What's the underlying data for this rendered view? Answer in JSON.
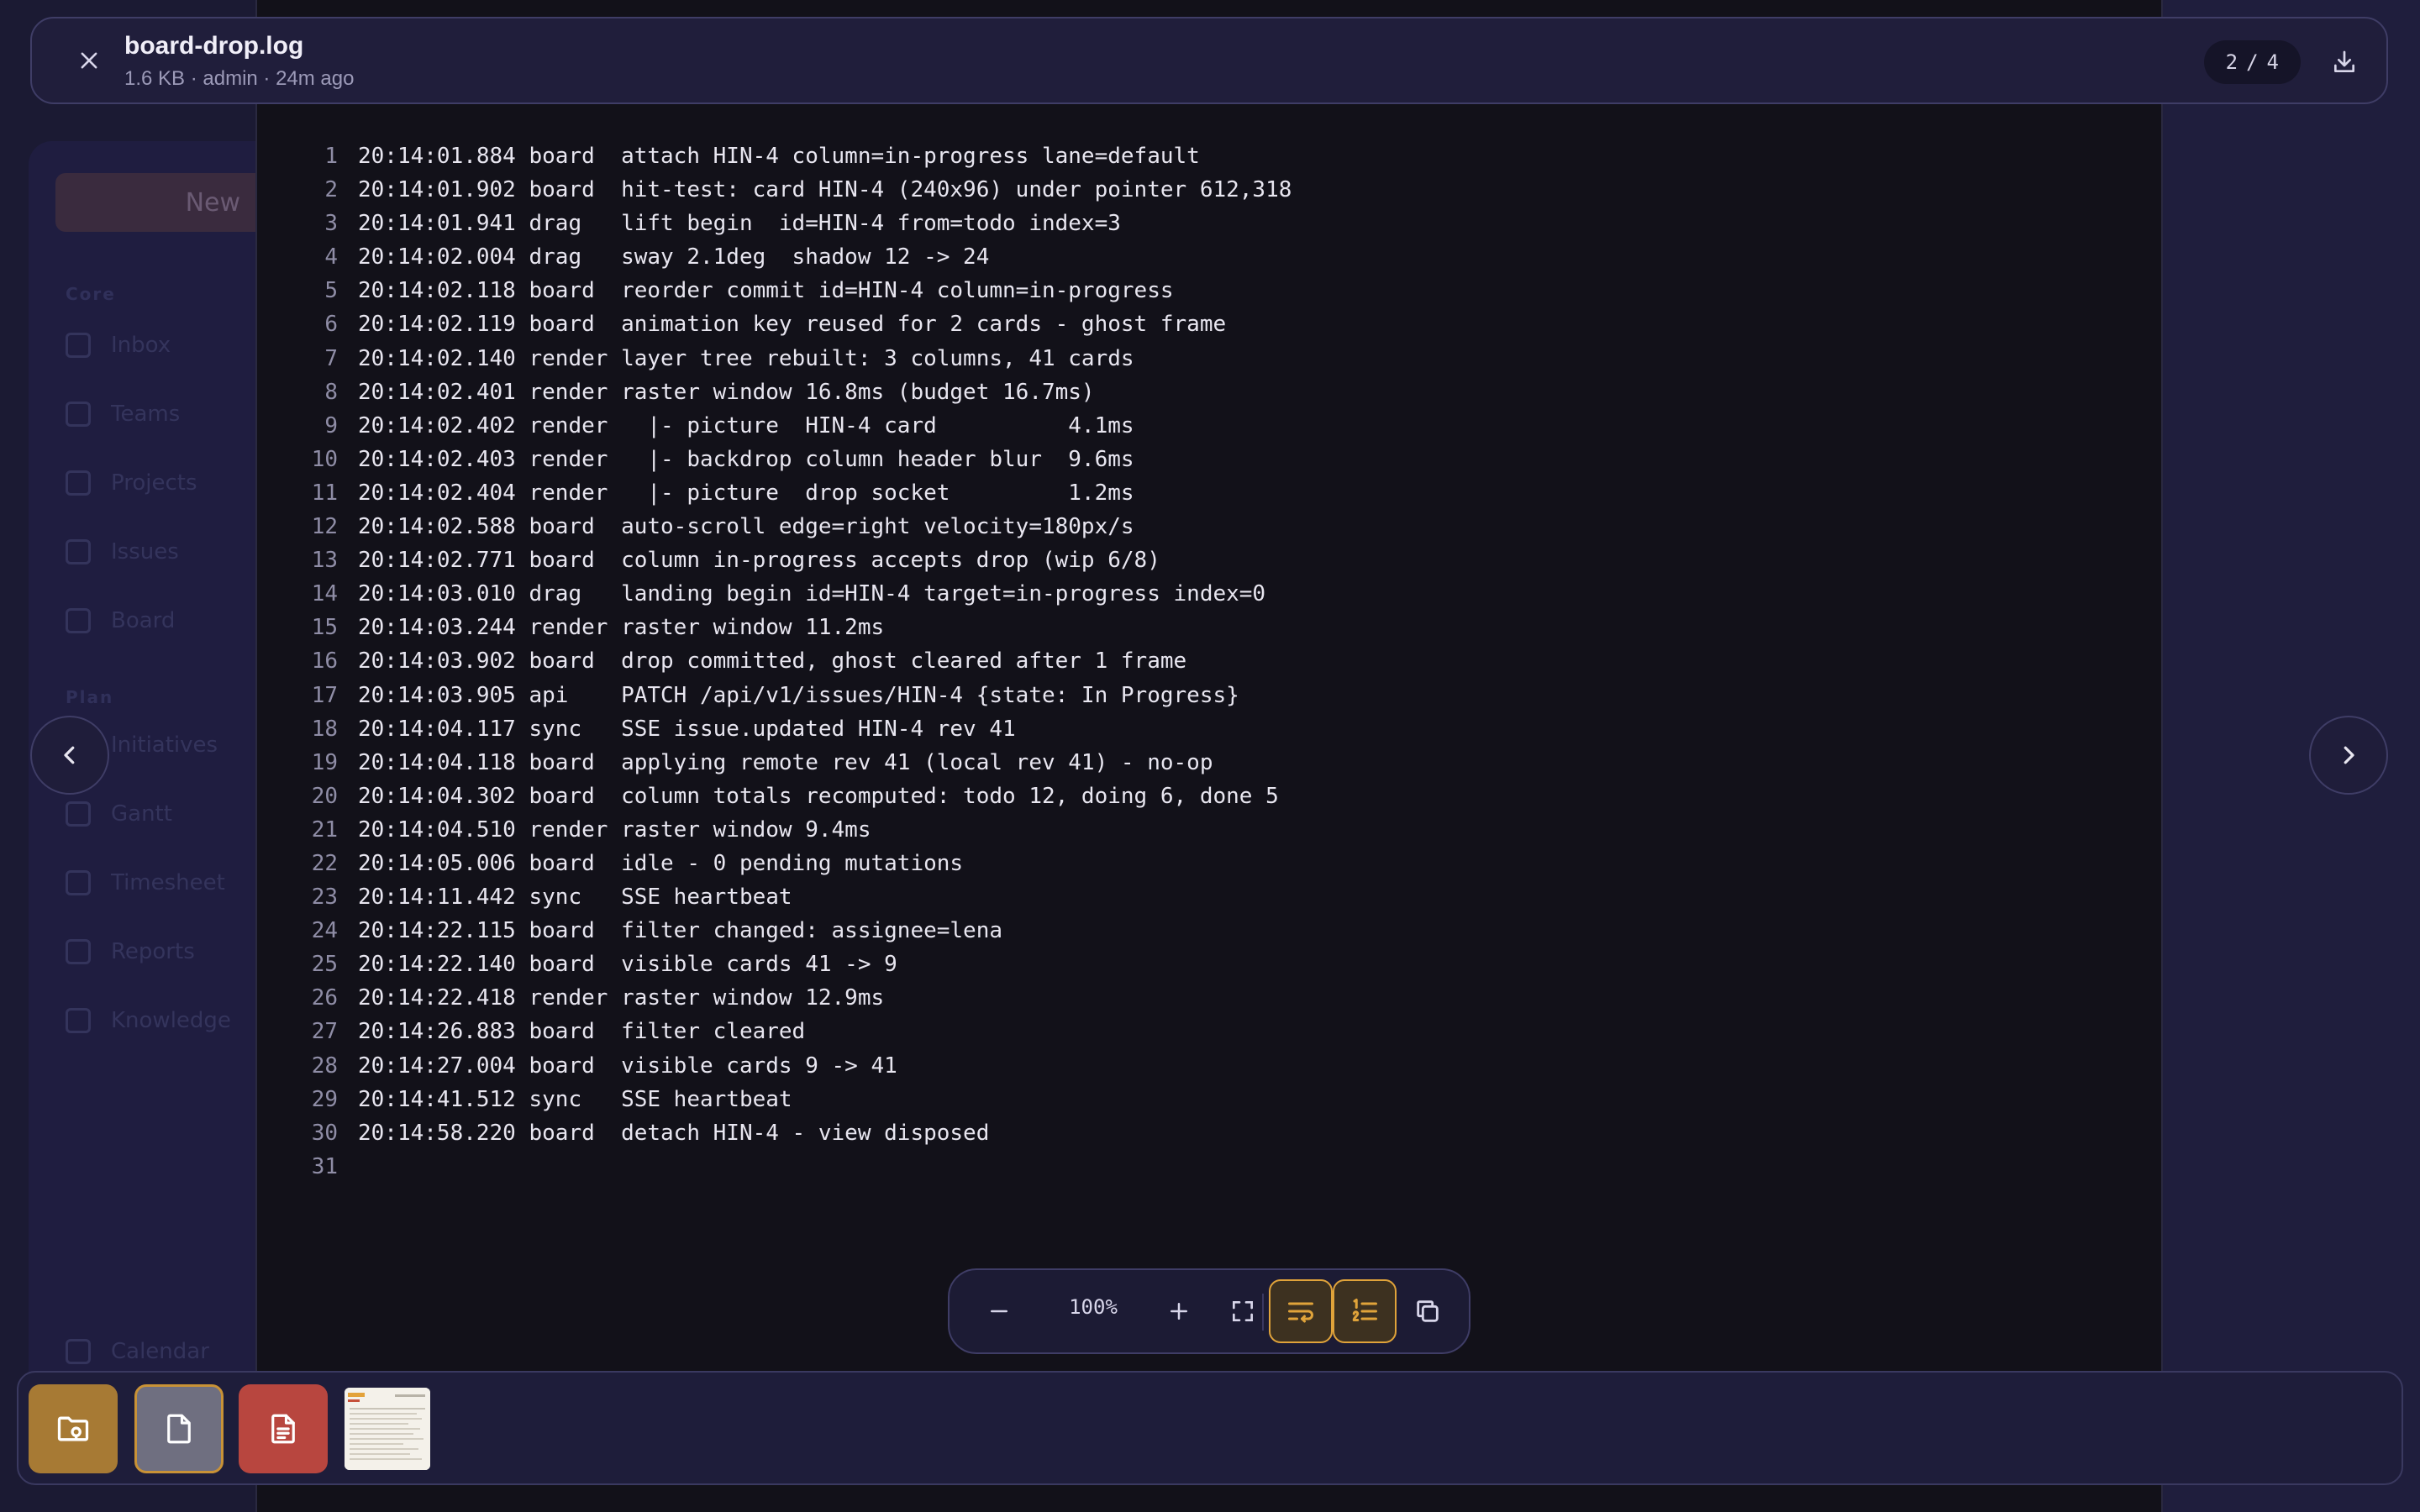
{
  "file": {
    "name": "board-drop.log",
    "meta": "1.6 KB · admin · 24m ago"
  },
  "pager": {
    "current": "2",
    "separator": "/",
    "total": "4"
  },
  "log_lines": [
    {
      "n": "1",
      "text": "20:14:01.884 board  attach HIN-4 column=in-progress lane=default"
    },
    {
      "n": "2",
      "text": "20:14:01.902 board  hit-test: card HIN-4 (240x96) under pointer 612,318"
    },
    {
      "n": "3",
      "text": "20:14:01.941 drag   lift begin  id=HIN-4 from=todo index=3"
    },
    {
      "n": "4",
      "text": "20:14:02.004 drag   sway 2.1deg  shadow 12 -> 24"
    },
    {
      "n": "5",
      "text": "20:14:02.118 board  reorder commit id=HIN-4 column=in-progress"
    },
    {
      "n": "6",
      "text": "20:14:02.119 board  animation key reused for 2 cards - ghost frame"
    },
    {
      "n": "7",
      "text": "20:14:02.140 render layer tree rebuilt: 3 columns, 41 cards"
    },
    {
      "n": "8",
      "text": "20:14:02.401 render raster window 16.8ms (budget 16.7ms)"
    },
    {
      "n": "9",
      "text": "20:14:02.402 render   |- picture  HIN-4 card          4.1ms"
    },
    {
      "n": "10",
      "text": "20:14:02.403 render   |- backdrop column header blur  9.6ms"
    },
    {
      "n": "11",
      "text": "20:14:02.404 render   |- picture  drop socket         1.2ms"
    },
    {
      "n": "12",
      "text": "20:14:02.588 board  auto-scroll edge=right velocity=180px/s"
    },
    {
      "n": "13",
      "text": "20:14:02.771 board  column in-progress accepts drop (wip 6/8)"
    },
    {
      "n": "14",
      "text": "20:14:03.010 drag   landing begin id=HIN-4 target=in-progress index=0"
    },
    {
      "n": "15",
      "text": "20:14:03.244 render raster window 11.2ms"
    },
    {
      "n": "16",
      "text": "20:14:03.902 board  drop committed, ghost cleared after 1 frame"
    },
    {
      "n": "17",
      "text": "20:14:03.905 api    PATCH /api/v1/issues/HIN-4 {state: In Progress}"
    },
    {
      "n": "18",
      "text": "20:14:04.117 sync   SSE issue.updated HIN-4 rev 41"
    },
    {
      "n": "19",
      "text": "20:14:04.118 board  applying remote rev 41 (local rev 41) - no-op"
    },
    {
      "n": "20",
      "text": "20:14:04.302 board  column totals recomputed: todo 12, doing 6, done 5"
    },
    {
      "n": "21",
      "text": "20:14:04.510 render raster window 9.4ms"
    },
    {
      "n": "22",
      "text": "20:14:05.006 board  idle - 0 pending mutations"
    },
    {
      "n": "23",
      "text": "20:14:11.442 sync   SSE heartbeat"
    },
    {
      "n": "24",
      "text": "20:14:22.115 board  filter changed: assignee=lena"
    },
    {
      "n": "25",
      "text": "20:14:22.140 board  visible cards 41 -> 9"
    },
    {
      "n": "26",
      "text": "20:14:22.418 render raster window 12.9ms"
    },
    {
      "n": "27",
      "text": "20:14:26.883 board  filter cleared"
    },
    {
      "n": "28",
      "text": "20:14:27.004 board  visible cards 9 -> 41"
    },
    {
      "n": "29",
      "text": "20:14:41.512 sync   SSE heartbeat"
    },
    {
      "n": "30",
      "text": "20:14:58.220 board  detach HIN-4 - view disposed"
    },
    {
      "n": "31",
      "text": ""
    }
  ],
  "toolbar": {
    "zoom": "100%",
    "icons": [
      "zoom-out-icon",
      "zoom-in-icon",
      "fullscreen-icon",
      "wrap-lines-icon",
      "line-numbers-icon",
      "copy-icon"
    ],
    "wrap_active": true,
    "line_numbers_active": true
  },
  "background": {
    "new_button": "New",
    "sections": [
      "Core",
      "Plan"
    ],
    "nav_items": [
      "Inbox",
      "Teams",
      "Projects",
      "Issues",
      "Board",
      "Initiatives",
      "Gantt",
      "Timesheet",
      "Reports",
      "Knowledge",
      "Calendar"
    ]
  },
  "tray": {
    "items": [
      "folder-thumbnail",
      "document-thumbnail",
      "pdf-thumbnail",
      "image-thumbnail"
    ],
    "selected": "document-thumbnail"
  },
  "colors": {
    "accent": "#e0a33a",
    "panel": "#121119",
    "topbar": "#201e3b",
    "folder": "#a77a34",
    "pdf": "#b8463f"
  }
}
